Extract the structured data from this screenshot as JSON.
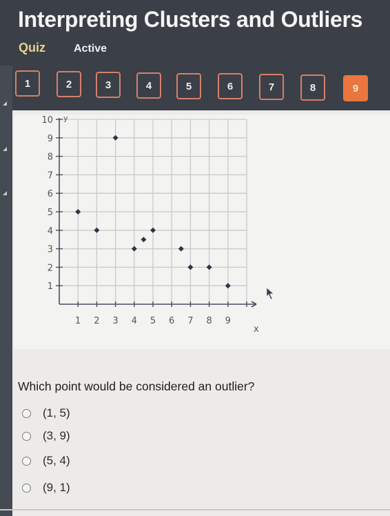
{
  "header": {
    "title": "Interpreting Clusters and Outliers",
    "quiz_label": "Quiz",
    "status_label": "Active"
  },
  "question_nav": {
    "items": [
      {
        "label": "1",
        "active": false
      },
      {
        "label": "2",
        "active": false
      },
      {
        "label": "3",
        "active": false
      },
      {
        "label": "4",
        "active": false
      },
      {
        "label": "5",
        "active": false
      },
      {
        "label": "6",
        "active": false
      },
      {
        "label": "7",
        "active": false
      },
      {
        "label": "8",
        "active": false
      },
      {
        "label": "9",
        "active": true
      }
    ]
  },
  "colors": {
    "header_bg": "#3b3f47",
    "active_accent": "#e8763e",
    "quiz_label": "#e6d38a",
    "button_border": "#d6806a"
  },
  "chart_data": {
    "type": "scatter",
    "title": "",
    "xlabel": "x",
    "ylabel": "y",
    "xlim": [
      0,
      10
    ],
    "ylim": [
      0,
      10
    ],
    "grid": true,
    "x_ticks": [
      "1",
      "2",
      "3",
      "4",
      "5",
      "6",
      "7",
      "8",
      "9"
    ],
    "y_ticks": [
      "1",
      "2",
      "3",
      "4",
      "5",
      "6",
      "7",
      "8",
      "9",
      "10"
    ],
    "points": [
      {
        "x": 1,
        "y": 5
      },
      {
        "x": 2,
        "y": 4
      },
      {
        "x": 3,
        "y": 9
      },
      {
        "x": 4,
        "y": 3
      },
      {
        "x": 4.5,
        "y": 3.5
      },
      {
        "x": 5,
        "y": 4
      },
      {
        "x": 6.5,
        "y": 3
      },
      {
        "x": 7,
        "y": 2
      },
      {
        "x": 8,
        "y": 2
      },
      {
        "x": 9,
        "y": 1
      }
    ]
  },
  "question": {
    "text": "Which point would be considered an outlier?",
    "options": [
      "(1, 5)",
      "(3, 9)",
      "(5, 4)",
      "(9, 1)"
    ]
  }
}
